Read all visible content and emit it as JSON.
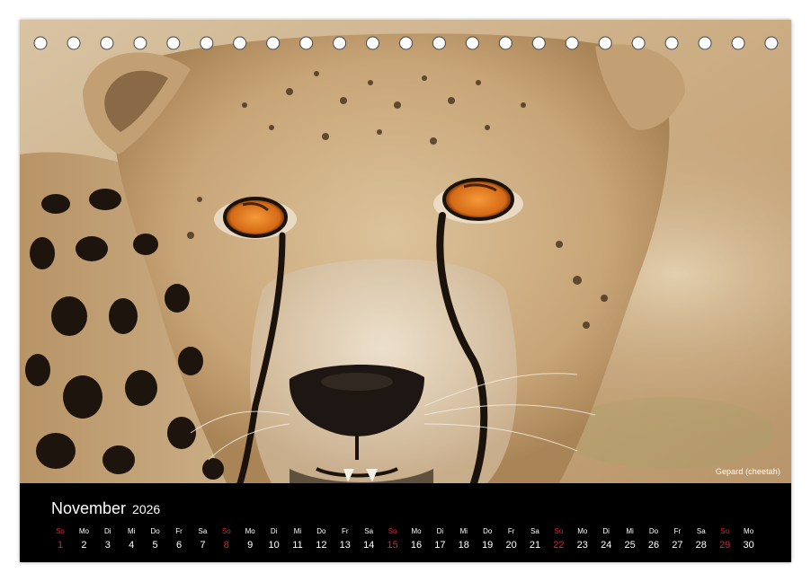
{
  "month": "November",
  "year": "2026",
  "photo_caption": "Gepard (cheetah)",
  "ring_hole_count": 23,
  "colors": {
    "band": "#000000",
    "text": "#ffffff",
    "sunday": "#e2202a",
    "ring_hole": "#ffffff"
  },
  "days": [
    {
      "name": "So",
      "num": "1",
      "sunday": true
    },
    {
      "name": "Mo",
      "num": "2",
      "sunday": false
    },
    {
      "name": "Di",
      "num": "3",
      "sunday": false
    },
    {
      "name": "Mi",
      "num": "4",
      "sunday": false
    },
    {
      "name": "Do",
      "num": "5",
      "sunday": false
    },
    {
      "name": "Fr",
      "num": "6",
      "sunday": false
    },
    {
      "name": "Sa",
      "num": "7",
      "sunday": false
    },
    {
      "name": "So",
      "num": "8",
      "sunday": true
    },
    {
      "name": "Mo",
      "num": "9",
      "sunday": false
    },
    {
      "name": "Di",
      "num": "10",
      "sunday": false
    },
    {
      "name": "Mi",
      "num": "11",
      "sunday": false
    },
    {
      "name": "Do",
      "num": "12",
      "sunday": false
    },
    {
      "name": "Fr",
      "num": "13",
      "sunday": false
    },
    {
      "name": "Sa",
      "num": "14",
      "sunday": false
    },
    {
      "name": "So",
      "num": "15",
      "sunday": true
    },
    {
      "name": "Mo",
      "num": "16",
      "sunday": false
    },
    {
      "name": "Di",
      "num": "17",
      "sunday": false
    },
    {
      "name": "Mi",
      "num": "18",
      "sunday": false
    },
    {
      "name": "Do",
      "num": "19",
      "sunday": false
    },
    {
      "name": "Fr",
      "num": "20",
      "sunday": false
    },
    {
      "name": "Sa",
      "num": "21",
      "sunday": false
    },
    {
      "name": "So",
      "num": "22",
      "sunday": true
    },
    {
      "name": "Mo",
      "num": "23",
      "sunday": false
    },
    {
      "name": "Di",
      "num": "24",
      "sunday": false
    },
    {
      "name": "Mi",
      "num": "25",
      "sunday": false
    },
    {
      "name": "Do",
      "num": "26",
      "sunday": false
    },
    {
      "name": "Fr",
      "num": "27",
      "sunday": false
    },
    {
      "name": "Sa",
      "num": "28",
      "sunday": false
    },
    {
      "name": "So",
      "num": "29",
      "sunday": true
    },
    {
      "name": "Mo",
      "num": "30",
      "sunday": false
    }
  ]
}
